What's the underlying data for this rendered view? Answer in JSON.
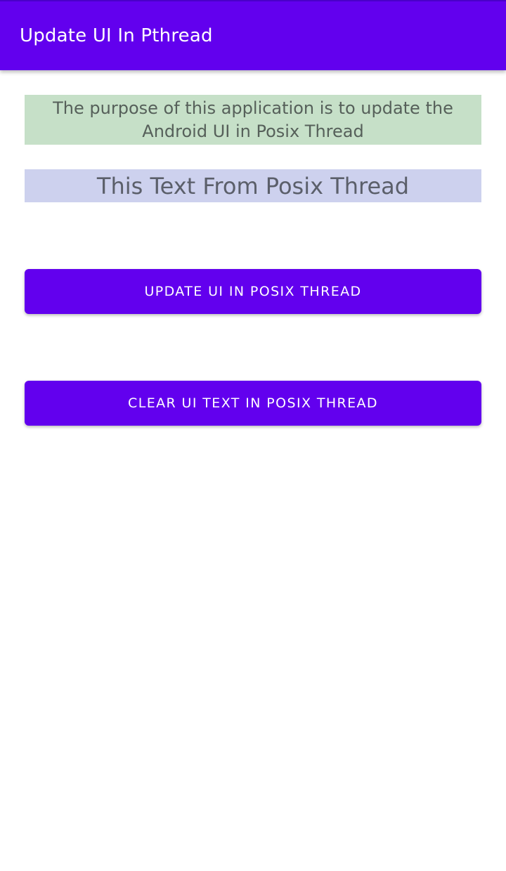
{
  "app_bar": {
    "title": "Update UI In Pthread",
    "color": "#6200ee"
  },
  "main": {
    "purpose_text": "The purpose of this application is to update the Android UI in Posix Thread",
    "purpose_bg": "#c6e0c8",
    "thread_text": "This Text From Posix Thread",
    "thread_bg": "#cdd1ee",
    "update_button_label": "UPDATE UI IN POSIX THREAD",
    "clear_button_label": "CLEAR UI TEXT IN POSIX THREAD",
    "button_color": "#6200ee"
  }
}
